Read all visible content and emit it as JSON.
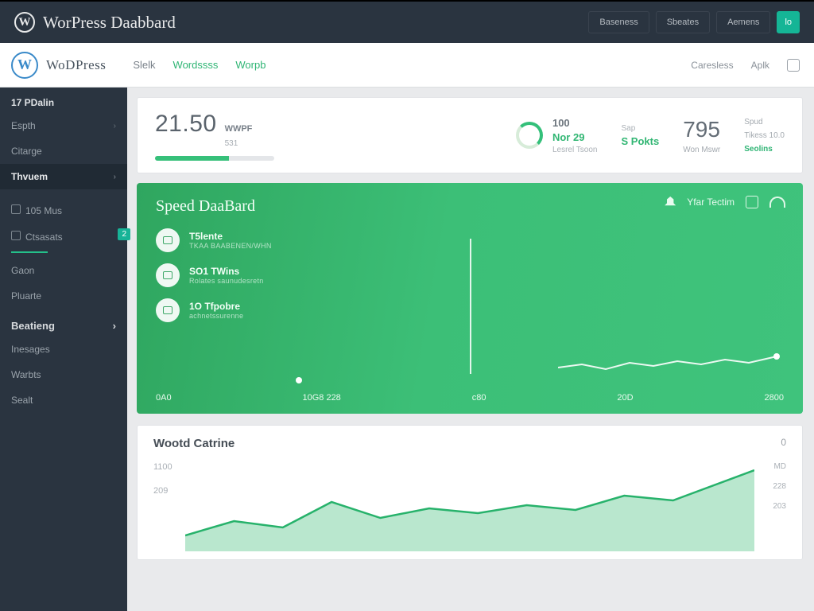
{
  "titlebar": {
    "title": "WorPress Daabbard",
    "tabs": [
      "Baseness",
      "Sbeates",
      "Aemens"
    ],
    "accent_tab": "lo"
  },
  "subhead": {
    "brand": "WoDPress",
    "nav": {
      "a": "Slelk",
      "b": "Wordssss",
      "c": "Worpb"
    },
    "right": {
      "a": "Caresless",
      "b": "Aplk"
    }
  },
  "sidebar": {
    "section1_title": "17 PDalin",
    "items1": [
      "Espth",
      "Citarge"
    ],
    "active": "Thvuem",
    "items2": [
      {
        "label": "105 Mus"
      },
      {
        "label": "Ctsasats",
        "badge": "2"
      }
    ],
    "items3": [
      "Gaon",
      "Pluarte"
    ],
    "group2_title": "Beatieng",
    "items4": [
      "Inesages",
      "Warbts",
      "Sealt"
    ]
  },
  "stats": {
    "big_num": "21.50",
    "big_label": "WWPF",
    "big_sub": "531",
    "mid_val": "100",
    "mid_label": "Nor 29",
    "mid_caption": "Lesrel Tsoon",
    "mid_right_label": "S Pokts",
    "mid_top_label": "Sap",
    "right_num": "795",
    "right_line1": "Tikess 10.0",
    "right_line2": "Won Mswr",
    "right_line3": "Seolins",
    "rcol_top": "Spud"
  },
  "hero": {
    "title": "Speed DaaBard",
    "action_label": "Yfar Tectim",
    "list": [
      {
        "title": "T5lente",
        "sub": "TKAA BAABENEN/WHN"
      },
      {
        "title": "SO1 TWins",
        "sub": "Rolates  saunudesretn"
      },
      {
        "title": "1O Tfpobre",
        "sub": "achnetssurenne"
      }
    ],
    "xaxis": [
      "0A0",
      "10G8  228",
      "c80",
      "20D",
      "2800"
    ]
  },
  "card": {
    "title": "Wootd Catrine",
    "corner": "0",
    "ylabels": [
      "1100",
      "209"
    ],
    "rylabels": [
      "MD",
      "228",
      "203"
    ]
  },
  "chart_data": [
    {
      "type": "line",
      "title": "Speed DaaBard sparkline",
      "x": [
        0,
        1,
        2,
        3,
        4,
        5,
        6,
        7,
        8,
        9
      ],
      "values": [
        12,
        14,
        11,
        15,
        13,
        16,
        14,
        17,
        15,
        18
      ],
      "ylim": [
        0,
        30
      ]
    },
    {
      "type": "area",
      "title": "Wootd Catrine",
      "x": [
        0,
        1,
        2,
        3,
        4,
        5,
        6,
        7,
        8,
        9,
        10,
        11
      ],
      "values": [
        220,
        300,
        260,
        480,
        360,
        440,
        400,
        470,
        430,
        560,
        520,
        900
      ],
      "ylabel": "",
      "ylim": [
        0,
        1100
      ]
    }
  ]
}
